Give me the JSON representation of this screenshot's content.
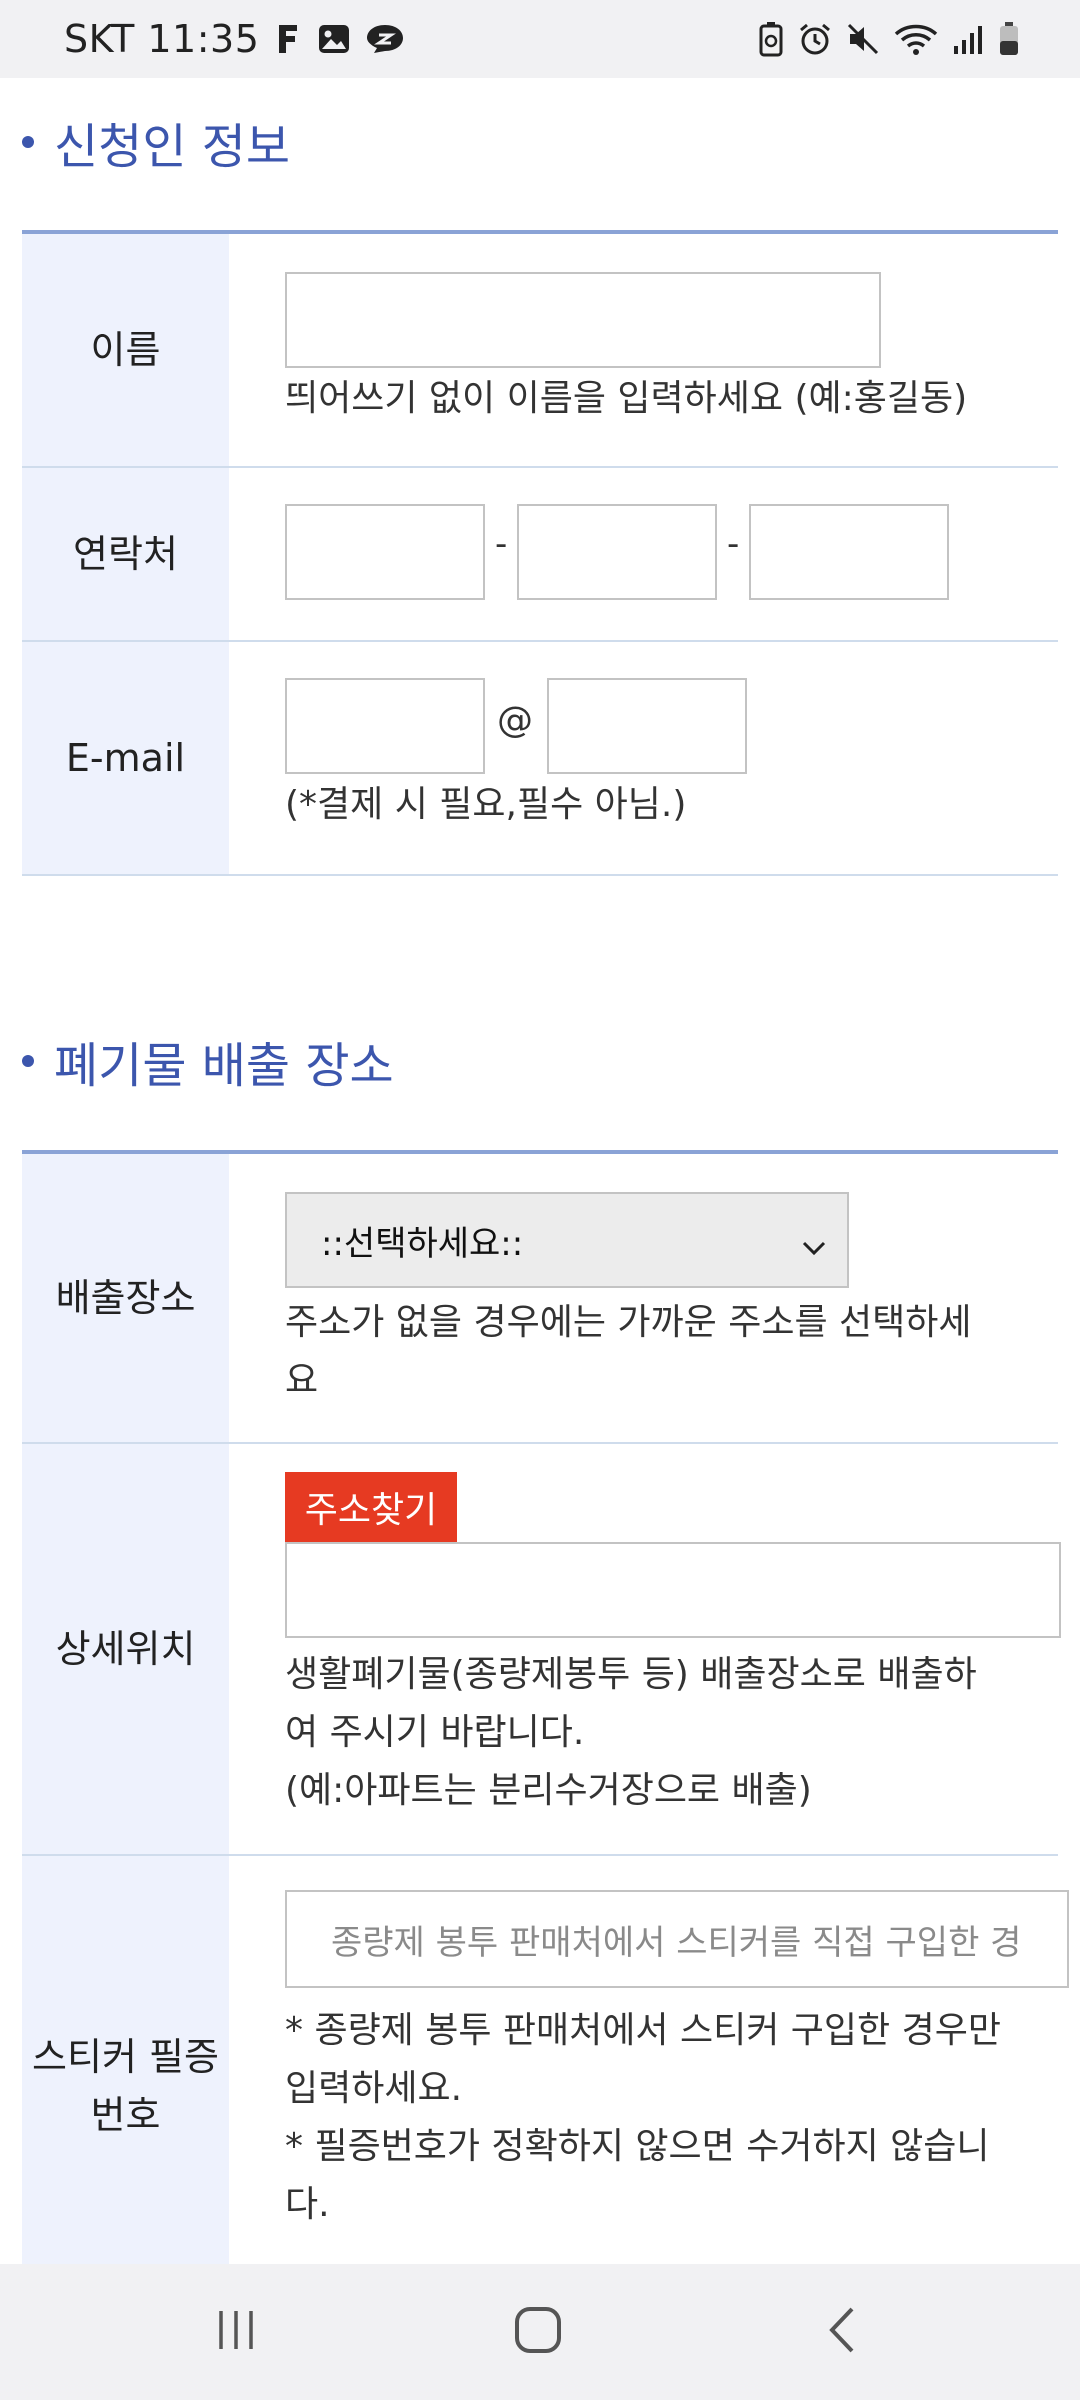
{
  "status_bar": {
    "carrier_time": "SKT 11:35",
    "left_icons": [
      "facebook-icon",
      "gallery-icon",
      "chat-icon"
    ],
    "right_icons": [
      "battery-saver-icon",
      "alarm-icon",
      "mute-icon",
      "wifi-icon",
      "signal-icon",
      "battery-icon"
    ]
  },
  "applicant_section": {
    "title": "신청인 정보",
    "name": {
      "label": "이름",
      "value": "",
      "helper": "띄어쓰기 없이 이름을 입력하세요 (예:홍길동)"
    },
    "contact": {
      "label": "연락처",
      "part1": "",
      "part2": "",
      "part3": "",
      "separator": "-"
    },
    "email": {
      "label": "E-mail",
      "local": "",
      "domain": "",
      "at": "@",
      "helper": "(*결제 시 필요,필수 아님.)"
    }
  },
  "disposal_section": {
    "title": "폐기물 배출 장소",
    "location": {
      "label": "배출장소",
      "selected": "::선택하세요::",
      "helper_line1": "주소가 없을 경우에는 가까운 주소를 선택하세",
      "helper_line2": "요"
    },
    "detail": {
      "label": "상세위치",
      "find_button": "주소찾기",
      "value": "",
      "helper_line1": "생활폐기물(종량제봉투 등) 배출장소로 배출하",
      "helper_line2": "여 주시기 바랍니다.",
      "helper_line3": "(예:아파트는 분리수거장으로 배출)"
    },
    "sticker": {
      "label_line1": "스티커 필증",
      "label_line2": "번호",
      "placeholder": "종량제 봉투 판매처에서 스티커를 직접 구입한 경",
      "note_line1": "* 종량제 봉투 판매처에서 스티커 구입한 경우만",
      "note_line2": "입력하세요.",
      "note_line3": "* 필증번호가 정확하지 않으면 수거하지 않습니",
      "note_line4": "다."
    }
  },
  "nav_bar": {
    "recent_icon": "recent-apps-icon",
    "home_icon": "home-icon",
    "back_icon": "back-icon"
  }
}
